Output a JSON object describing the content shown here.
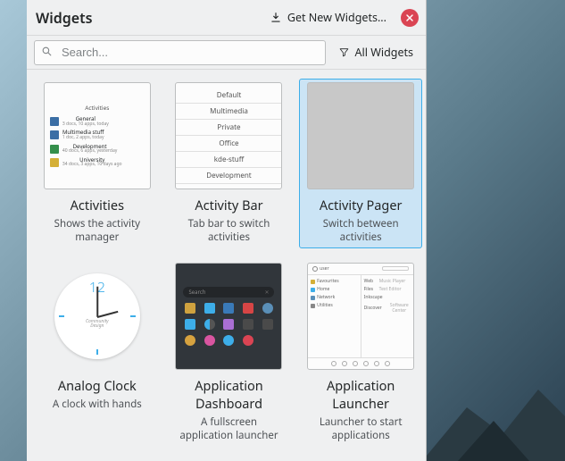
{
  "header": {
    "title": "Widgets",
    "get_new": "Get New Widgets..."
  },
  "toolbar": {
    "search_placeholder": "Search...",
    "filter_label": "All Widgets"
  },
  "widgets": [
    {
      "title": "Activities",
      "desc": "Shows the activity manager"
    },
    {
      "title": "Activity Bar",
      "desc": "Tab bar to switch activities"
    },
    {
      "title": "Activity Pager",
      "desc": "Switch between activities"
    },
    {
      "title": "Analog Clock",
      "desc": "A clock with hands"
    },
    {
      "title": "Application Dashboard",
      "desc": "A fullscreen application launcher"
    },
    {
      "title": "Application Launcher",
      "desc": "Launcher to start applications"
    }
  ],
  "thumbs": {
    "activities": {
      "header": "Activities",
      "rows": [
        {
          "name": "General",
          "sub": "3 docs, 10 apps, today"
        },
        {
          "name": "Multimedia stuff",
          "sub": "1 doc, 2 apps, today"
        },
        {
          "name": "Development",
          "sub": "40 docs, 6 apps, yesterday"
        },
        {
          "name": "University",
          "sub": "34 docs, 3 apps, 10 days ago"
        }
      ]
    },
    "bar": [
      "Default",
      "Multimedia",
      "Private",
      "Office",
      "kde-stuff",
      "Development"
    ],
    "dash_search": "Search",
    "launcher": {
      "user": "user",
      "left": [
        "Favourites",
        "Home",
        "Network",
        "Utilities"
      ],
      "right_a": [
        "Web",
        "Files",
        "Inkscape",
        "Discover"
      ],
      "right_b": [
        "Music Player",
        "Text Editor",
        "",
        "Software Center"
      ]
    },
    "clock": {
      "num": "12",
      "brand1": "Community",
      "brand2": "Design"
    }
  }
}
